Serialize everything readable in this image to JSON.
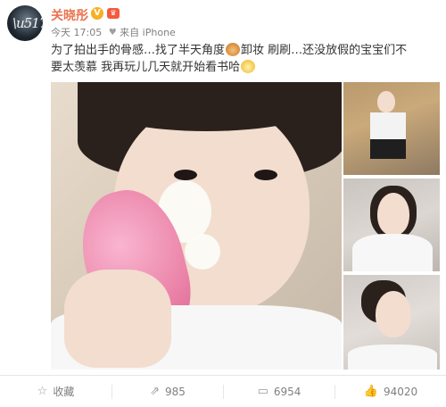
{
  "user": {
    "name": "关晓彤",
    "verified_badge": "V",
    "vip_badge": "♛"
  },
  "meta": {
    "time": "今天 17:05",
    "source_prefix": "来自",
    "source": "iPhone"
  },
  "post": {
    "text_part1": "为了拍出手的骨感…找了半天角度",
    "text_part2": "卸妆 刷刷…还没放假的宝宝们不要太羡慕 我再玩儿几天就开始看书哈"
  },
  "actions": {
    "favorite_label": "收藏",
    "repost_count": "985",
    "comment_count": "6954",
    "like_count": "94020"
  },
  "colors": {
    "username": "#eb7350",
    "verified": "#f6b023",
    "text": "#333333",
    "meta": "#808080"
  }
}
